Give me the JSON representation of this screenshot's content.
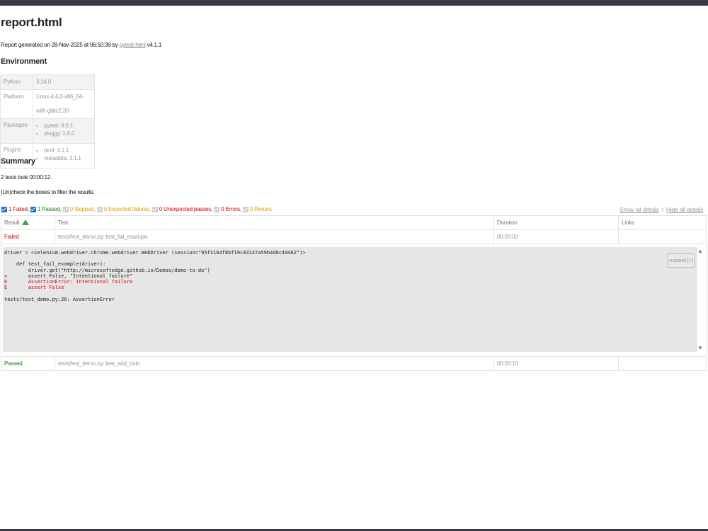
{
  "title": "report.html",
  "generated": {
    "prefix": "Report generated on 28-Nov-2025 at 06:50:39 by ",
    "link": "pytest-html",
    "suffix": " v4.1.1"
  },
  "environment": {
    "heading": "Environment",
    "python_label": "Python",
    "python_value": "3.14.0",
    "platform_label": "Platform",
    "platform_value": "Linux-4.4.0-x86_64-with-glibc2.39",
    "packages_label": "Packages",
    "packages": [
      "pytest: 9.0.1",
      "pluggy: 1.6.0"
    ],
    "plugins_label": "Plugins",
    "plugins": [
      "html: 4.1.1",
      "metadata: 3.1.1"
    ]
  },
  "summary": {
    "heading": "Summary",
    "took": "2 tests took 00:00:12.",
    "hint": "(Un)check the boxes to filter the results."
  },
  "filters": {
    "failed": "1 Failed,",
    "passed": "1 Passed,",
    "skipped": "0 Skipped,",
    "xfailed": "0 Expected failures,",
    "xpassed": "0 Unexpected passes,",
    "errors": "0 Errors,",
    "reruns": "0 Reruns"
  },
  "detail_links": {
    "show": "Show all details",
    "sep": "/",
    "hide": "Hide all details"
  },
  "table": {
    "headers": [
      "Result",
      "Test",
      "Duration",
      "Links"
    ],
    "rows": [
      {
        "result": "Failed",
        "test": "tests/test_demo.py::test_fail_example",
        "duration": "00:00:02",
        "links": ""
      },
      {
        "result": "Passed",
        "test": "tests/test_demo.py::test_add_todo",
        "duration": "00:00:10",
        "links": ""
      }
    ]
  },
  "log": {
    "line1": "driver = <selenium.webdriver.chrome.webdriver.WebDriver (session=\"95f3164f8bf19c83137a59b4d0c49462\")>",
    "line2": "",
    "line3": "    def test_fail_example(driver):",
    "line4": "        driver.get(\"http://microsoftedge.github.io/Demos/demo-to-do\")",
    "line5": ">       assert False, \"Intentional failure\"",
    "line6": "E       AssertionError: Intentional failure",
    "line7": "E       assert False",
    "line8": "",
    "line9": "tests/test_demo.py:26: AssertionError",
    "expand": "expand [+]"
  }
}
